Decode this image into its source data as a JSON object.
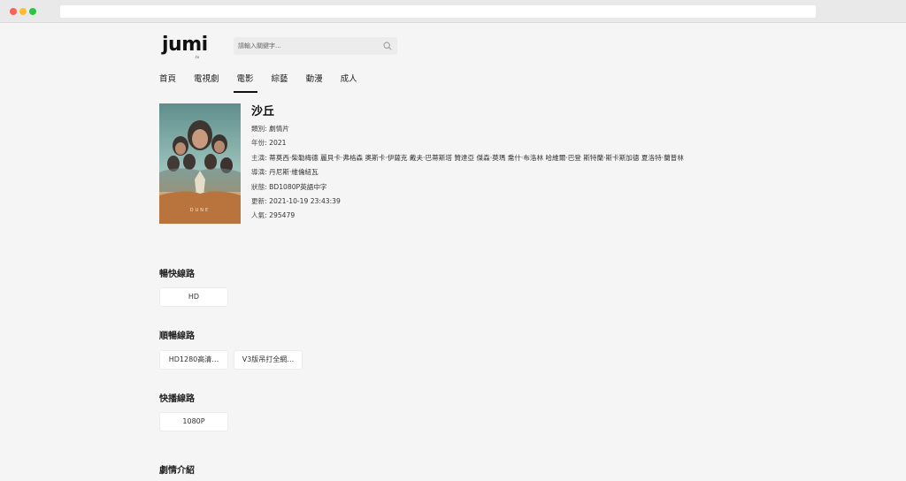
{
  "header": {
    "logo_text": "JUMI",
    "logo_sub": ".tv",
    "search_placeholder": "請輸入關鍵字..."
  },
  "nav": {
    "items": [
      {
        "label": "首頁"
      },
      {
        "label": "電視劇"
      },
      {
        "label": "電影"
      },
      {
        "label": "綜藝"
      },
      {
        "label": "動漫"
      },
      {
        "label": "成人"
      }
    ],
    "active_index": 2
  },
  "movie": {
    "title": "沙丘",
    "poster_text": "DUNE",
    "fields": [
      {
        "key": "類別:",
        "value": "劇情片"
      },
      {
        "key": "年份:",
        "value": "2021"
      },
      {
        "key": "主演:",
        "value": "蒂莫西·柴勒梅德 麗貝卡·弗格森 奧斯卡·伊薩克 戴夫·巴蒂斯塔 贊達亞 傑森·莫瑪 喬什·布洛林 哈維爾·巴登 斯特蘭·斯卡斯加德 夏洛特·蘭普林"
      },
      {
        "key": "導演:",
        "value": "丹尼斯·維倫紐瓦"
      },
      {
        "key": "狀態:",
        "value": "BD1080P英語中字"
      },
      {
        "key": "更新:",
        "value": "2021-10-19 23:43:39"
      },
      {
        "key": "人氣:",
        "value": "295479"
      }
    ]
  },
  "sources": [
    {
      "title": "暢快線路",
      "buttons": [
        "HD"
      ]
    },
    {
      "title": "順暢線路",
      "buttons": [
        "HD1280高清…",
        "V3版吊打全網…"
      ]
    },
    {
      "title": "快播線路",
      "buttons": [
        "1080P"
      ]
    }
  ],
  "synopsis_title": "劇情介紹",
  "colors": {
    "background": "#f5f5f5",
    "active_underline": "#111111",
    "poster_sky": "#8fb8b3",
    "poster_sand": "#c98a4f"
  }
}
